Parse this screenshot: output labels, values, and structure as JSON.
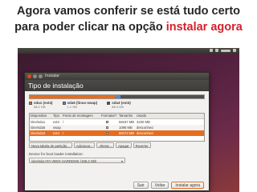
{
  "caption": {
    "line1": "Agora vamos conferir se está tudo certo",
    "line2_prefix": "para poder clicar na opção ",
    "line2_highlight": "instalar agora"
  },
  "colors": {
    "caption_highlight": "#d4202c",
    "accent_orange": "#e66d1f",
    "swap_blue": "#5b88c4",
    "free_gray": "#4f4f4f"
  },
  "window": {
    "title": "Instalar",
    "banner": "Tipo de instalação"
  },
  "partition_bar": {
    "fractions": [
      0.49,
      0.03,
      0.48
    ],
    "legend": [
      {
        "name": "sda1 (ext4)",
        "size": "58.2 GB",
        "color": "#e66d1f"
      },
      {
        "name": "sda5 (linux-swap)",
        "size": "1.1 GB",
        "color": "#5b88c4"
      },
      {
        "name": "sda3 (ext4)",
        "size": "88.4 GB",
        "color": "#4f4f4f"
      }
    ]
  },
  "table": {
    "headers": [
      "Dispositivo",
      "Tipo",
      "Ponto de montagem",
      "Formatar?",
      "Tamanho",
      "Usado"
    ],
    "rows": [
      {
        "device": "/dev/sda1",
        "type": "ext4",
        "mount": "/",
        "format": false,
        "size": "58187 MB",
        "used": "3230 MB"
      },
      {
        "device": "/dev/sda5",
        "type": "swap",
        "mount": "",
        "format": false,
        "size": "1098 MB",
        "used": "desconhecido"
      },
      {
        "device": "/dev/sda3",
        "type": "ext4",
        "mount": "/",
        "format": true,
        "size": "88473 MB",
        "used": "desconhecido"
      }
    ]
  },
  "table_toolbar": [
    "Nova tabela de partição...",
    "Adicionar...",
    "Alterar...",
    "Apagar",
    "Reverter"
  ],
  "bootloader": {
    "label": "Device for boot loader installation:",
    "value": "/dev/sda   ATA VBOX HARDDISK (158.2 GB)"
  },
  "buttons": {
    "quit": "Sair",
    "back": "Voltar",
    "install": "Instalar agora"
  }
}
